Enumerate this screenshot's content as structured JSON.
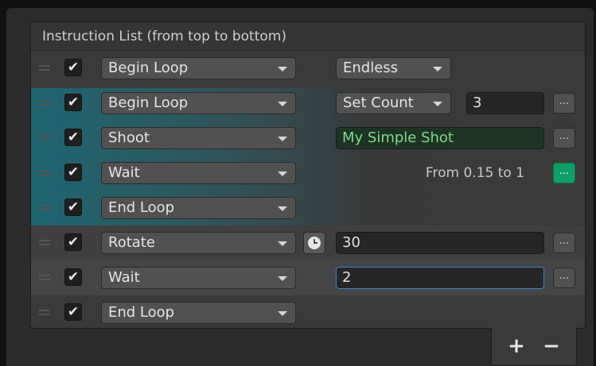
{
  "panel": {
    "title": "Instruction List (from top to bottom)"
  },
  "rows": [
    {
      "checked": true,
      "instruction": "Begin Loop",
      "mode": "Endless"
    },
    {
      "checked": true,
      "instruction": "Begin Loop",
      "mode": "Set Count",
      "value": "3",
      "more": "..."
    },
    {
      "checked": true,
      "instruction": "Shoot",
      "value": "My Simple Shot",
      "more": "..."
    },
    {
      "checked": true,
      "instruction": "Wait",
      "range_text": "From 0.15 to 1",
      "more": "..."
    },
    {
      "checked": true,
      "instruction": "End Loop"
    },
    {
      "checked": true,
      "instruction": "Rotate",
      "value": "30",
      "more": "..."
    },
    {
      "checked": true,
      "instruction": "Wait",
      "value": "2",
      "more": "..."
    },
    {
      "checked": true,
      "instruction": "End Loop"
    }
  ],
  "footer": {
    "add_label": "+",
    "remove_label": "−"
  },
  "icons": {
    "checkbox": "check-icon",
    "dropdown": "chevron-down-icon",
    "drag": "drag-handle-icon",
    "timer": "clock-icon"
  },
  "colors": {
    "accent_green": "#0f9d6a",
    "string_text_green": "#7fd88e",
    "focus_blue": "#3d7fd1",
    "indent_teal": "#1f6570"
  }
}
